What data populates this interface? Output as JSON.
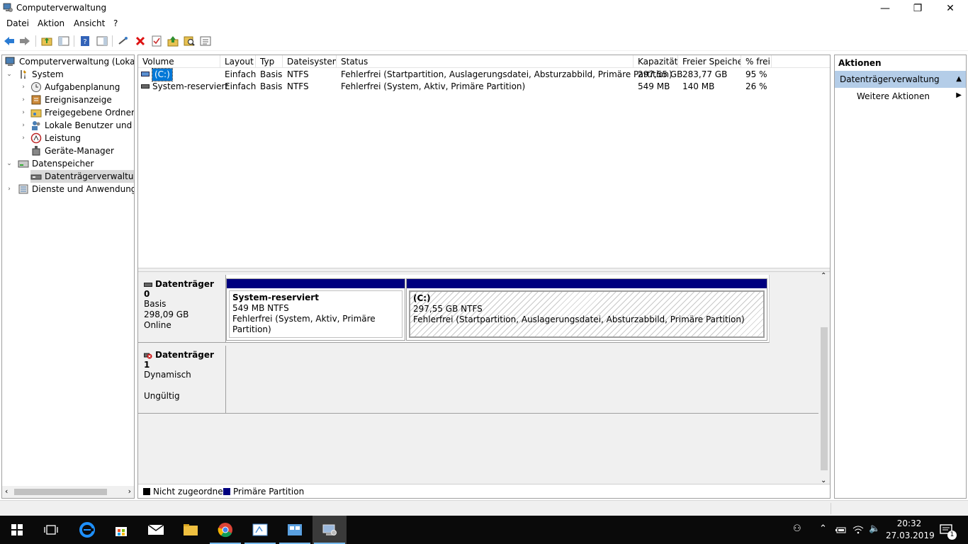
{
  "window": {
    "title": "Computerverwaltung",
    "min_glyph": "—",
    "max_glyph": "❐",
    "close_glyph": "✕"
  },
  "menu": [
    "Datei",
    "Aktion",
    "Ansicht",
    "?"
  ],
  "toolbar": {
    "icons": [
      "back-icon",
      "forward-icon",
      "up-folder-icon",
      "console-tree-icon",
      "help-icon",
      "properties-pane-icon",
      "connect-icon",
      "delete-icon",
      "check-icon",
      "upload-icon",
      "search-icon",
      "list-icon"
    ]
  },
  "tree": {
    "root": "Computerverwaltung (Lokal)",
    "system": "System",
    "aufgaben": "Aufgabenplanung",
    "ereignis": "Ereignisanzeige",
    "freigegeben": "Freigegebene Ordner",
    "lokale": "Lokale Benutzer und Gruppen",
    "leistung": "Leistung",
    "geraete": "Geräte-Manager",
    "datenspeicher": "Datenspeicher",
    "datentraeger": "Datenträgerverwaltung",
    "dienste": "Dienste und Anwendungen"
  },
  "volumes": {
    "columns": [
      "Volume",
      "Layout",
      "Typ",
      "Dateisystem",
      "Status",
      "Kapazität",
      "Freier Speicher",
      "% frei"
    ],
    "rows": [
      {
        "volume": "(C:)",
        "layout": "Einfach",
        "typ": "Basis",
        "fs": "NTFS",
        "status": "Fehlerfrei (Startpartition, Auslagerungsdatei, Absturzabbild, Primäre Partition)",
        "kap": "297,55 GB",
        "frei": "283,77 GB",
        "pct": "95 %"
      },
      {
        "volume": "System-reserviert",
        "layout": "Einfach",
        "typ": "Basis",
        "fs": "NTFS",
        "status": "Fehlerfrei (System, Aktiv, Primäre Partition)",
        "kap": "549 MB",
        "frei": "140 MB",
        "pct": "26 %"
      }
    ]
  },
  "disks": {
    "disk0": {
      "name": "Datenträger 0",
      "type": "Basis",
      "size": "298,09 GB",
      "state": "Online",
      "part1": {
        "name": "System-reserviert",
        "size": "549 MB NTFS",
        "status": "Fehlerfrei (System, Aktiv, Primäre Partition)"
      },
      "part2": {
        "name": "(C:)",
        "size": "297,55 GB NTFS",
        "status": "Fehlerfrei (Startpartition, Auslagerungsdatei, Absturzabbild, Primäre Partition)"
      }
    },
    "disk1": {
      "name": "Datenträger 1",
      "type": "Dynamisch",
      "state": "Ungültig"
    }
  },
  "legend": {
    "unallocated": "Nicht zugeordnet",
    "primary": "Primäre Partition",
    "unallocated_color": "#000000",
    "primary_color": "#00007f"
  },
  "actions": {
    "title": "Aktionen",
    "section": "Datenträgerverwaltung",
    "more": "Weitere Aktionen"
  },
  "taskbar": {
    "time": "20:32",
    "date": "27.03.2019",
    "notifications": "1"
  }
}
